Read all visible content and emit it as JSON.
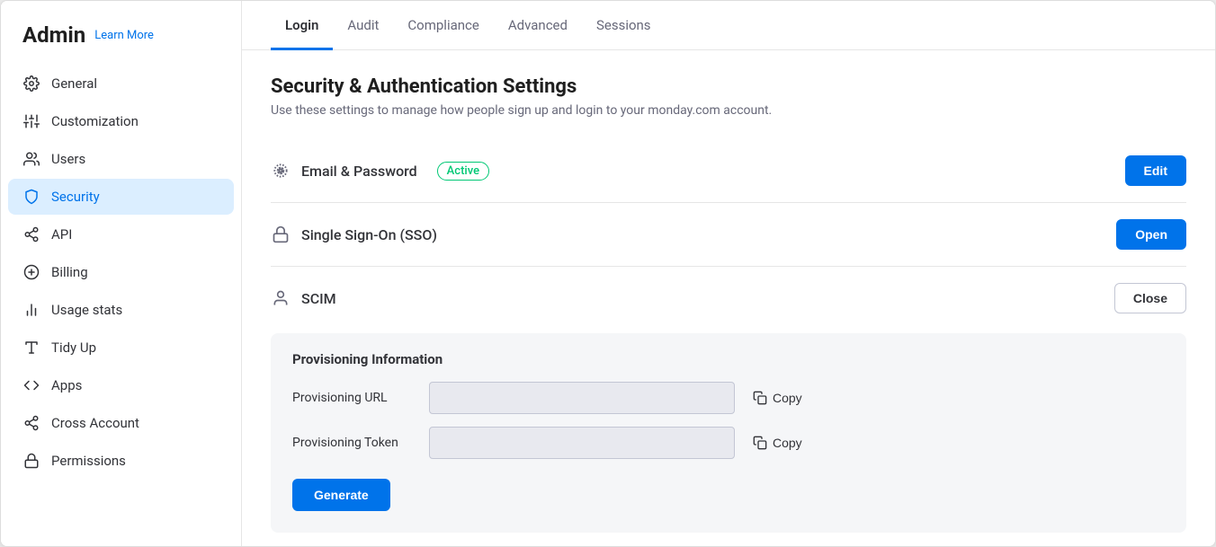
{
  "sidebar": {
    "title": "Admin",
    "learn_more": "Learn More",
    "items": [
      {
        "id": "general",
        "label": "General",
        "icon": "⚙",
        "active": false
      },
      {
        "id": "customization",
        "label": "Customization",
        "icon": "⚙",
        "active": false
      },
      {
        "id": "users",
        "label": "Users",
        "icon": "👤",
        "active": false
      },
      {
        "id": "security",
        "label": "Security",
        "icon": "🛡",
        "active": true
      },
      {
        "id": "api",
        "label": "API",
        "icon": "⚡",
        "active": false
      },
      {
        "id": "billing",
        "label": "Billing",
        "icon": "💲",
        "active": false
      },
      {
        "id": "usage-stats",
        "label": "Usage stats",
        "icon": "📊",
        "active": false
      },
      {
        "id": "tidy-up",
        "label": "Tidy Up",
        "icon": "🧹",
        "active": false
      },
      {
        "id": "apps",
        "label": "Apps",
        "icon": "◇",
        "active": false
      },
      {
        "id": "cross-account",
        "label": "Cross Account",
        "icon": "⚡",
        "active": false
      },
      {
        "id": "permissions",
        "label": "Permissions",
        "icon": "🔒",
        "active": false
      }
    ]
  },
  "tabs": [
    {
      "id": "login",
      "label": "Login",
      "active": true
    },
    {
      "id": "audit",
      "label": "Audit",
      "active": false
    },
    {
      "id": "compliance",
      "label": "Compliance",
      "active": false
    },
    {
      "id": "advanced",
      "label": "Advanced",
      "active": false
    },
    {
      "id": "sessions",
      "label": "Sessions",
      "active": false
    }
  ],
  "page": {
    "title": "Security & Authentication Settings",
    "subtitle": "Use these settings to manage how people sign up and login to your monday.com account."
  },
  "sections": {
    "email_password": {
      "icon": "∷",
      "title": "Email & Password",
      "badge": "Active",
      "edit_label": "Edit"
    },
    "sso": {
      "icon": "🔒",
      "title": "Single Sign-On (SSO)",
      "open_label": "Open"
    },
    "scim": {
      "icon": "👤",
      "title": "SCIM",
      "close_label": "Close",
      "provisioning": {
        "box_title": "Provisioning Information",
        "fields": [
          {
            "id": "url",
            "label": "Provisioning URL",
            "value": "",
            "placeholder": ""
          },
          {
            "id": "token",
            "label": "Provisioning Token",
            "value": "",
            "placeholder": ""
          }
        ],
        "copy_label": "Copy",
        "generate_label": "Generate"
      }
    }
  }
}
